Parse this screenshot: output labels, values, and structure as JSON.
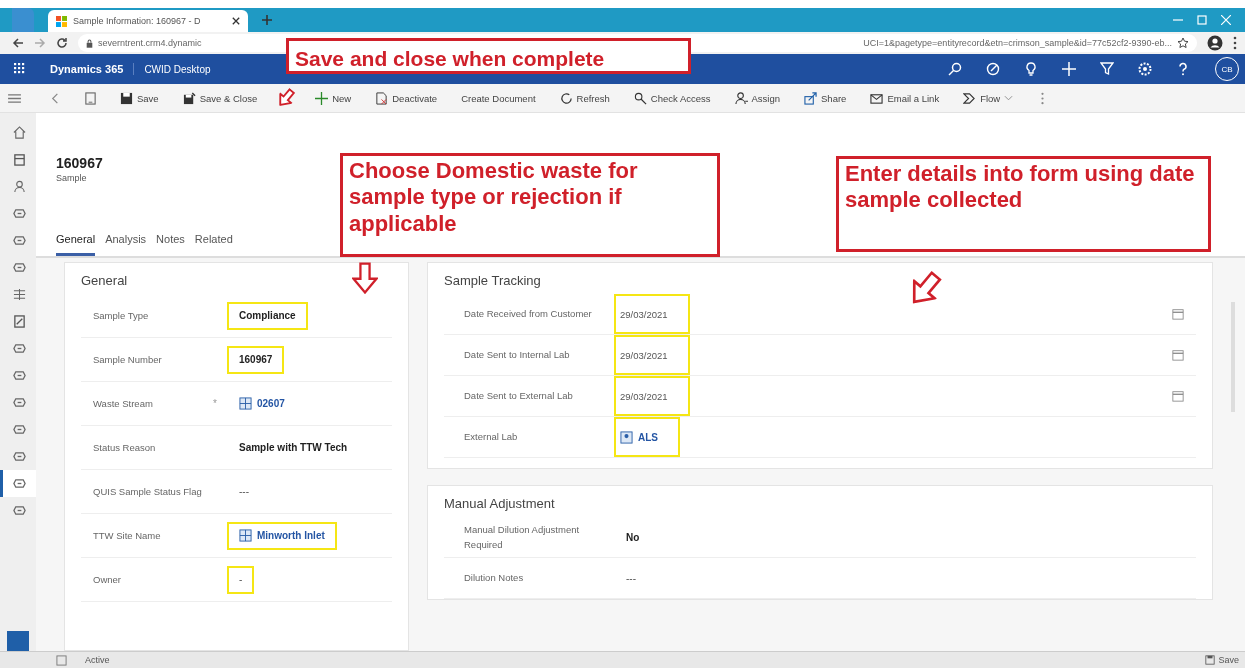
{
  "browser": {
    "tab_title": "Sample Information: 160967 - D",
    "url_start": "severntrent.crm4.dynamic",
    "url_end": "UCI=1&pagetype=entityrecord&etn=crimson_sample&id=77c52cf2-9390-eb..."
  },
  "app_bar": {
    "app_name": "Dynamics 365",
    "area": "CWID Desktop",
    "avatar": "CB"
  },
  "command_bar": [
    {
      "kind": "back"
    },
    {
      "kind": "form"
    },
    {
      "kind": "save",
      "label": "Save"
    },
    {
      "kind": "save-close",
      "label": "Save & Close"
    },
    {
      "kind": "new",
      "label": "New"
    },
    {
      "kind": "deactivate",
      "label": "Deactivate"
    },
    {
      "kind": "plain",
      "label": "Create Document"
    },
    {
      "kind": "refresh",
      "label": "Refresh"
    },
    {
      "kind": "check",
      "label": "Check Access"
    },
    {
      "kind": "assign",
      "label": "Assign"
    },
    {
      "kind": "share",
      "label": "Share"
    },
    {
      "kind": "email",
      "label": "Email a Link"
    },
    {
      "kind": "flow",
      "label": "Flow"
    },
    {
      "kind": "more"
    }
  ],
  "nav_rail": [
    {
      "kind": "home",
      "selected": false
    },
    {
      "kind": "recent",
      "selected": false
    },
    {
      "kind": "person",
      "selected": false
    },
    {
      "kind": "entity",
      "selected": false
    },
    {
      "kind": "entity",
      "selected": false
    },
    {
      "kind": "entity",
      "selected": false
    },
    {
      "kind": "list",
      "selected": false
    },
    {
      "kind": "notes",
      "selected": false
    },
    {
      "kind": "entity",
      "selected": false
    },
    {
      "kind": "entity",
      "selected": false
    },
    {
      "kind": "entity",
      "selected": false
    },
    {
      "kind": "entity",
      "selected": false
    },
    {
      "kind": "entity",
      "selected": false
    },
    {
      "kind": "entity",
      "selected": true
    },
    {
      "kind": "entity",
      "selected": false
    }
  ],
  "record": {
    "title": "160967",
    "entity": "Sample",
    "tabs": [
      {
        "label": "General",
        "selected": true
      },
      {
        "label": "Analysis",
        "selected": false
      },
      {
        "label": "Notes",
        "selected": false
      },
      {
        "label": "Related",
        "selected": false
      }
    ]
  },
  "general": {
    "title": "General",
    "fields": [
      {
        "label": "Sample Type",
        "value": "Compliance",
        "kind": "text",
        "highlighted": true
      },
      {
        "label": "Sample Number",
        "value": "160967",
        "kind": "text",
        "highlighted": true
      },
      {
        "label": "Waste Stream",
        "marker": "*",
        "value": "02607",
        "kind": "lookup",
        "highlighted": false
      },
      {
        "label": "Status Reason",
        "value": "Sample with TTW Tech",
        "kind": "text",
        "highlighted": false
      },
      {
        "label": "QUIS Sample Status Flag",
        "value": "---",
        "kind": "empty",
        "highlighted": false
      },
      {
        "label": "TTW Site Name",
        "value": "Minworth Inlet",
        "kind": "lookup",
        "highlighted": true
      },
      {
        "label": "Owner",
        "value": "-",
        "kind": "empty",
        "highlighted": true
      }
    ]
  },
  "tracking": {
    "title": "Sample Tracking",
    "fields": [
      {
        "label": "Date Received from Customer",
        "value": "29/03/2021",
        "kind": "date",
        "highlighted": true
      },
      {
        "label": "Date Sent to Internal Lab",
        "value": "29/03/2021",
        "kind": "date",
        "highlighted": true
      },
      {
        "label": "Date Sent to External Lab",
        "value": "29/03/2021",
        "kind": "date",
        "highlighted": true
      },
      {
        "label": "External Lab",
        "value": "ALS",
        "kind": "account",
        "highlighted": true
      }
    ]
  },
  "manual": {
    "title": "Manual Adjustment",
    "fields": [
      {
        "label": "Manual Dilution Adjustment Required",
        "value": "No",
        "kind": "text",
        "highlighted": false
      },
      {
        "label": "Dilution Notes",
        "value": "---",
        "kind": "empty",
        "highlighted": false
      }
    ]
  },
  "status_bar": {
    "status": "Active",
    "save": "Save"
  },
  "annotations": [
    {
      "text": "Save and close when complete"
    },
    {
      "text": "Choose Domestic waste for sample type or rejection if applicable"
    },
    {
      "text": "Enter details into form using date sample collected"
    }
  ]
}
